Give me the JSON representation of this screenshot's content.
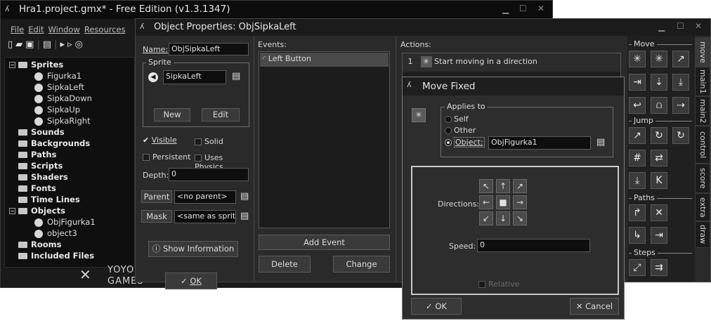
{
  "main_window": {
    "title": "Hra1.project.gmx* -  Free Edition (v1.3.1347)",
    "menu": [
      "File",
      "Edit",
      "Window",
      "Resources"
    ],
    "tree": [
      {
        "label": "Sprites",
        "kind": "folder-open",
        "level": 0
      },
      {
        "label": "Figurka1",
        "kind": "sprite",
        "level": 1
      },
      {
        "label": "SipkaLeft",
        "kind": "sprite",
        "level": 1
      },
      {
        "label": "SipkaDown",
        "kind": "sprite",
        "level": 1
      },
      {
        "label": "SipkaUp",
        "kind": "sprite",
        "level": 1
      },
      {
        "label": "SipkaRight",
        "kind": "sprite",
        "level": 1
      },
      {
        "label": "Sounds",
        "kind": "folder",
        "level": 0
      },
      {
        "label": "Backgrounds",
        "kind": "folder",
        "level": 0
      },
      {
        "label": "Paths",
        "kind": "folder",
        "level": 0
      },
      {
        "label": "Scripts",
        "kind": "folder",
        "level": 0
      },
      {
        "label": "Shaders",
        "kind": "folder",
        "level": 0
      },
      {
        "label": "Fonts",
        "kind": "folder",
        "level": 0
      },
      {
        "label": "Time Lines",
        "kind": "folder",
        "level": 0
      },
      {
        "label": "Objects",
        "kind": "folder-open",
        "level": 0
      },
      {
        "label": "ObjFigurka1",
        "kind": "sprite",
        "level": 1
      },
      {
        "label": "object3",
        "kind": "sprite",
        "level": 1
      },
      {
        "label": "Rooms",
        "kind": "folder",
        "level": 0
      },
      {
        "label": "Included Files",
        "kind": "folder",
        "level": 0
      }
    ],
    "logo_top": "YOYO",
    "logo_bottom": "GAMES"
  },
  "object_window": {
    "title": "Object Properties: ObjSipkaLeft",
    "name_label": "Name:",
    "name_value": "ObjSipkaLeft",
    "sprite_group": "Sprite",
    "sprite_value": "SipkaLeft",
    "new_btn": "New",
    "edit_btn": "Edit",
    "visible": "Visible",
    "solid": "Solid",
    "persistent": "Persistent",
    "uses_physics": "Uses Physics",
    "depth_label": "Depth:",
    "depth_value": "0",
    "parent_btn": "Parent",
    "parent_value": "<no parent>",
    "mask_btn": "Mask",
    "mask_value": "<same as sprite>",
    "show_info_btn": "Show Information",
    "ok_btn": "OK",
    "events_label": "Events:",
    "events": [
      "Left Button"
    ],
    "add_event_btn": "Add Event",
    "delete_btn": "Delete",
    "change_btn": "Change",
    "actions_label": "Actions:",
    "actions": [
      {
        "num": "1",
        "label": "Start moving in a direction"
      }
    ],
    "groups": {
      "move": "Move",
      "jump": "Jump",
      "paths": "Paths",
      "steps": "Steps"
    },
    "tabs": [
      "move",
      "main1",
      "main2",
      "control",
      "score",
      "extra",
      "draw"
    ]
  },
  "move_fixed": {
    "title": "Move Fixed",
    "applies_to": "Applies to",
    "self": "Self",
    "other": "Other",
    "object": "Object:",
    "object_value": "ObjFigurka1",
    "directions_label": "Directions:",
    "speed_label": "Speed:",
    "speed_value": "0",
    "relative": "Relative",
    "ok_btn": "OK",
    "cancel_btn": "Cancel"
  }
}
